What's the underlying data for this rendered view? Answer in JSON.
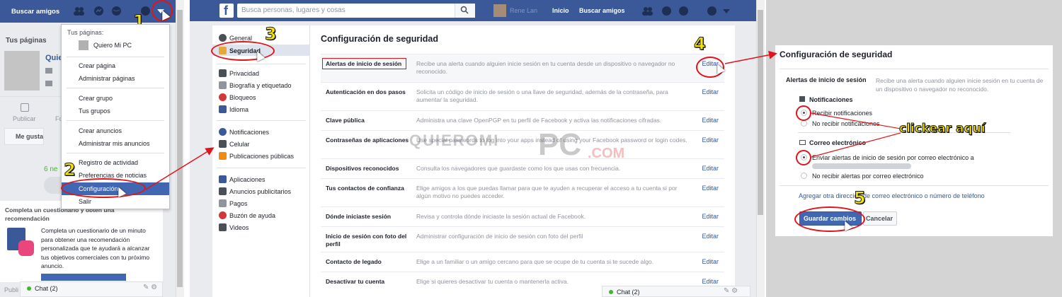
{
  "panel1": {
    "topbar_link": "Buscar amigos",
    "your_pages_heading": "Tus páginas",
    "page_name_partial": "Quie",
    "publish_label": "Publicar",
    "publish_label2": "Fo",
    "like_button": "Me gusta",
    "partial_text": "6 ne",
    "questionnaire_title": "Completa un cuestionario y obtén una recomendación",
    "questionnaire_body": "Completa un cuestionario de un minuto para obtener una recomendación personalizada que te ayudará a alcanzar tus objetivos comerciales con tu próximo anuncio.",
    "bottom_partial": "Publi",
    "chat_label": "Chat (2)",
    "dropdown": {
      "header": "Tus páginas:",
      "page_item": "Quiero Mi PC",
      "items": [
        "Crear página",
        "Administrar páginas",
        "Crear grupo",
        "Tus grupos",
        "Crear anuncios",
        "Administrar mis anuncios",
        "Registro de actividad",
        "Preferencias de noticias",
        "Configuración",
        "Salir"
      ]
    }
  },
  "panel2": {
    "search_placeholder": "Busca personas, lugares y cosas",
    "profile_name": "Rene Lan",
    "nav_home": "Inicio",
    "nav_find_friends": "Buscar amigos",
    "sidebar_groups": [
      [
        "General",
        "Seguridad"
      ],
      [
        "Privacidad",
        "Biografía y etiquetado",
        "Bloqueos",
        "Idioma"
      ],
      [
        "Notificaciones",
        "Celular",
        "Publicaciones públicas"
      ],
      [
        "Aplicaciones",
        "Anuncios publicitarios",
        "Pagos",
        "Buzón de ayuda",
        "Videos"
      ]
    ],
    "title": "Configuración de seguridad",
    "edit_label": "Editar",
    "rows": [
      {
        "label": "Alertas de inicio de sesión",
        "desc": "Recibe una alerta cuando alguien inicie sesión en tu cuenta desde un dispositivo o navegador no reconocido."
      },
      {
        "label": "Autenticación en dos pasos",
        "desc": "Solicita un código de inicio de sesión o una llave de seguridad, además de la contraseña, para aumentar la seguridad."
      },
      {
        "label": "Clave pública",
        "desc": "Administra una clave OpenPGP en tu perfil de Facebook y activa las notificaciones cifradas."
      },
      {
        "label": "Contraseñas de aplicaciones",
        "desc": "Use special passwords to log into your apps instead of using your Facebook password or login codes."
      },
      {
        "label": "Dispositivos reconocidos",
        "desc": "Consulta los navegadores que guardaste como los que usas con frecuencia."
      },
      {
        "label": "Tus contactos de confianza",
        "desc": "Elige amigos a los que puedas llamar para que te ayuden a recuperar el acceso a tu cuenta si por algún motivo no puedes acceder."
      },
      {
        "label": "Dónde iniciaste sesión",
        "desc": "Revisa y controla dónde iniciaste la sesión actual de Facebook."
      },
      {
        "label": "Inicio de sesión con foto del perfil",
        "desc": "Administrar configuración de inicio de sesión con foto del perfil"
      },
      {
        "label": "Contacto de legado",
        "desc": "Elige a un familiar o un amigo cercano para que se ocupe de tu cuenta si te sucede algo."
      },
      {
        "label": "Desactivar tu cuenta",
        "desc": "Elige si quieres desactivar tu cuenta o mantenerla activa."
      }
    ],
    "chat_label": "Chat (2)",
    "watermark_top": "QUIEROMI",
    "watermark_mid": "PC",
    "watermark_end": ".COM"
  },
  "panel3": {
    "title": "Configuración de seguridad",
    "section_label": "Alertas de inicio de sesión",
    "section_desc": "Recibe una alerta cuando alguien inicie sesión en tu cuenta de un dispositivo o navegador no reconocido.",
    "notifications_heading": "Notificaciones",
    "opt_receive": "Recibir notificaciones",
    "opt_no_receive": "No recibir notificaciones",
    "email_heading": "Correo electrónico",
    "opt_email": "Enviar alertas de inicio de sesión por correo electrónico a",
    "opt_no_email": "No recibir alertas por correo electrónico",
    "add_link": "Agregar otra dirección de correo electrónico o número de teléfono",
    "save_button": "Guardar cambios",
    "cancel_button": "Cancelar"
  },
  "annotations": {
    "steps": [
      "1",
      "2",
      "3",
      "4",
      "5"
    ],
    "click_here": "clickear aquí"
  },
  "colors": {
    "facebook_blue": "#3b5998",
    "link_blue": "#365899",
    "annotation_red": "#e0151b",
    "annotation_yellow": "#f5e400"
  }
}
